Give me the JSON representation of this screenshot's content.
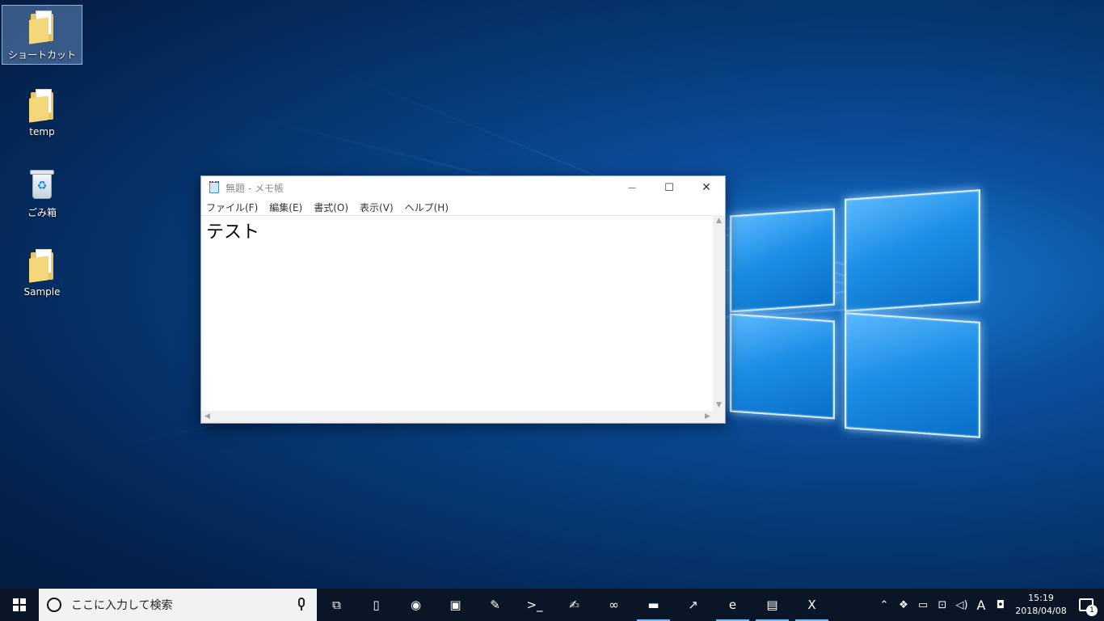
{
  "desktop": {
    "icons": [
      {
        "label": "ショートカット",
        "icon": "shortcut-folder-icon",
        "selected": true
      },
      {
        "label": "temp",
        "icon": "folder-icon"
      },
      {
        "label": "ごみ箱",
        "icon": "recycle-bin-icon"
      },
      {
        "label": "Sample",
        "icon": "folder-icon"
      }
    ]
  },
  "notepad": {
    "title": "無題 - メモ帳",
    "menu": [
      "ファイル(F)",
      "編集(E)",
      "書式(O)",
      "表示(V)",
      "ヘルプ(H)"
    ],
    "content": "テスト",
    "controls": {
      "minimize": "—",
      "maximize": "☐",
      "close": "✕"
    }
  },
  "taskbar": {
    "search_placeholder": "ここに入力して検索",
    "pinned": [
      {
        "name": "task-view-icon",
        "glyph": "⧉"
      },
      {
        "name": "blank-document-icon",
        "glyph": "▯"
      },
      {
        "name": "chrome-icon",
        "glyph": "◉"
      },
      {
        "name": "security-app-icon",
        "glyph": "▣"
      },
      {
        "name": "paint-icon",
        "glyph": "✎"
      },
      {
        "name": "command-prompt-icon",
        "glyph": ">_"
      },
      {
        "name": "signing-tool-icon",
        "glyph": "✍"
      },
      {
        "name": "visual-studio-icon",
        "glyph": "∞"
      },
      {
        "name": "file-explorer-icon",
        "glyph": "▬"
      },
      {
        "name": "chart-app-icon",
        "glyph": "↗"
      },
      {
        "name": "internet-explorer-icon",
        "glyph": "e"
      },
      {
        "name": "notepad-icon",
        "glyph": "▤"
      },
      {
        "name": "excel-icon",
        "glyph": "X"
      }
    ],
    "tray": {
      "time": "15:19",
      "date": "2018/04/08",
      "ime": "A",
      "notification_count": "1"
    }
  },
  "colors": {
    "taskbar": "#0a1525",
    "active_indicator": "#76b9ed",
    "selection": "#78a0d2"
  }
}
